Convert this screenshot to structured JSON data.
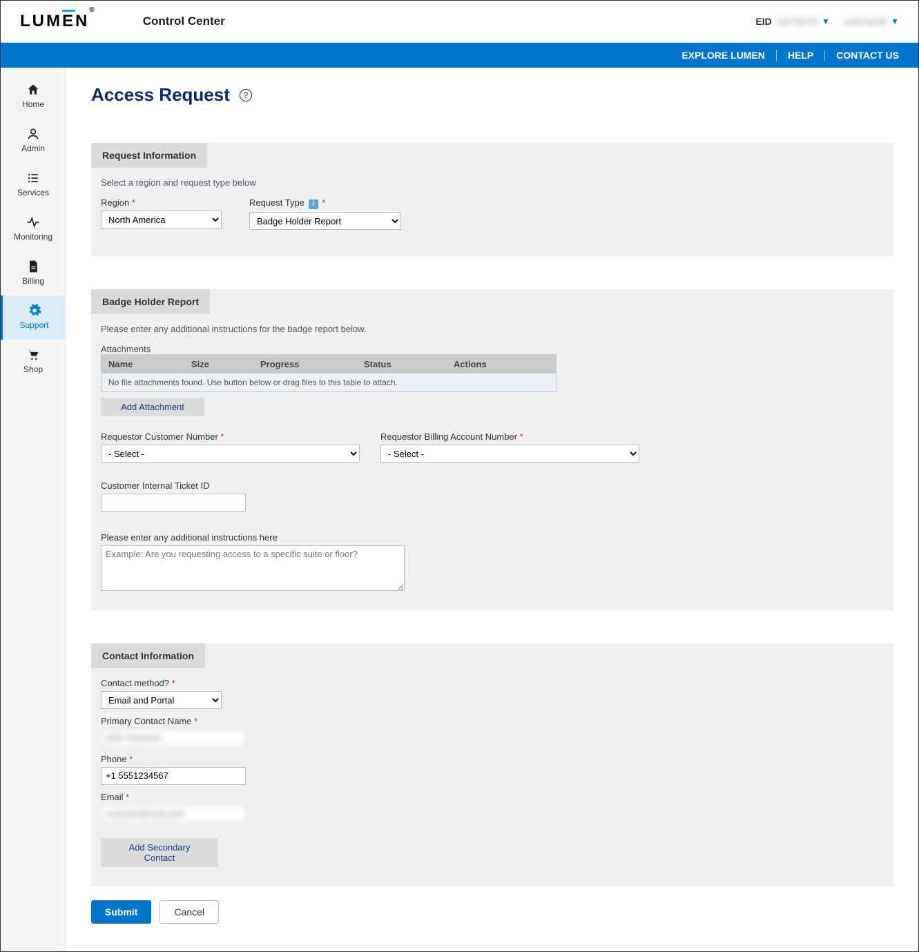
{
  "header": {
    "logo_text": "LUMEN",
    "app_name": "Control Center",
    "eid_label": "EID",
    "eid_value": "11176273",
    "user_name": "username"
  },
  "bluebar": {
    "explore": "EXPLORE LUMEN",
    "help": "HELP",
    "contact": "CONTACT US"
  },
  "sidebar": {
    "items": [
      {
        "label": "Home",
        "icon": "home"
      },
      {
        "label": "Admin",
        "icon": "user"
      },
      {
        "label": "Services",
        "icon": "list"
      },
      {
        "label": "Monitoring",
        "icon": "activity"
      },
      {
        "label": "Billing",
        "icon": "file"
      },
      {
        "label": "Support",
        "icon": "gear",
        "active": true
      },
      {
        "label": "Shop",
        "icon": "cart"
      }
    ]
  },
  "page": {
    "title": "Access Request"
  },
  "request_info": {
    "tab": "Request Information",
    "hint": "Select a region and request type below",
    "region_label": "Region",
    "region_value": "North America",
    "type_label": "Request Type",
    "type_value": "Badge Holder Report"
  },
  "badge": {
    "tab": "Badge Holder Report",
    "hint": "Please enter any additional instructions for the badge report below.",
    "attachments_label": "Attachments",
    "cols": {
      "name": "Name",
      "size": "Size",
      "progress": "Progress",
      "status": "Status",
      "actions": "Actions"
    },
    "empty_msg": "No file attachments found. Use button below or drag files to this table to attach.",
    "add_btn": "Add Attachment",
    "cust_num_label": "Requestor Customer Number",
    "cust_num_value": "- Select -",
    "bill_num_label": "Requestor Billing Account Number",
    "bill_num_value": "- Select -",
    "ticket_label": "Customer Internal Ticket ID",
    "ticket_value": "",
    "instr_label": "Please enter any additional instructions here",
    "instr_placeholder": "Example: Are you requesting access to a specific suite or floor?"
  },
  "contact": {
    "tab": "Contact Information",
    "method_label": "Contact method?",
    "method_value": "Email and Portal",
    "name_label": "Primary Contact Name",
    "name_value": "John Doeman",
    "phone_label": "Phone",
    "phone_value": "+1 5551234567",
    "email_label": "Email",
    "email_value": "example@mail.com",
    "add_secondary": "Add Secondary Contact"
  },
  "footer": {
    "submit": "Submit",
    "cancel": "Cancel"
  }
}
